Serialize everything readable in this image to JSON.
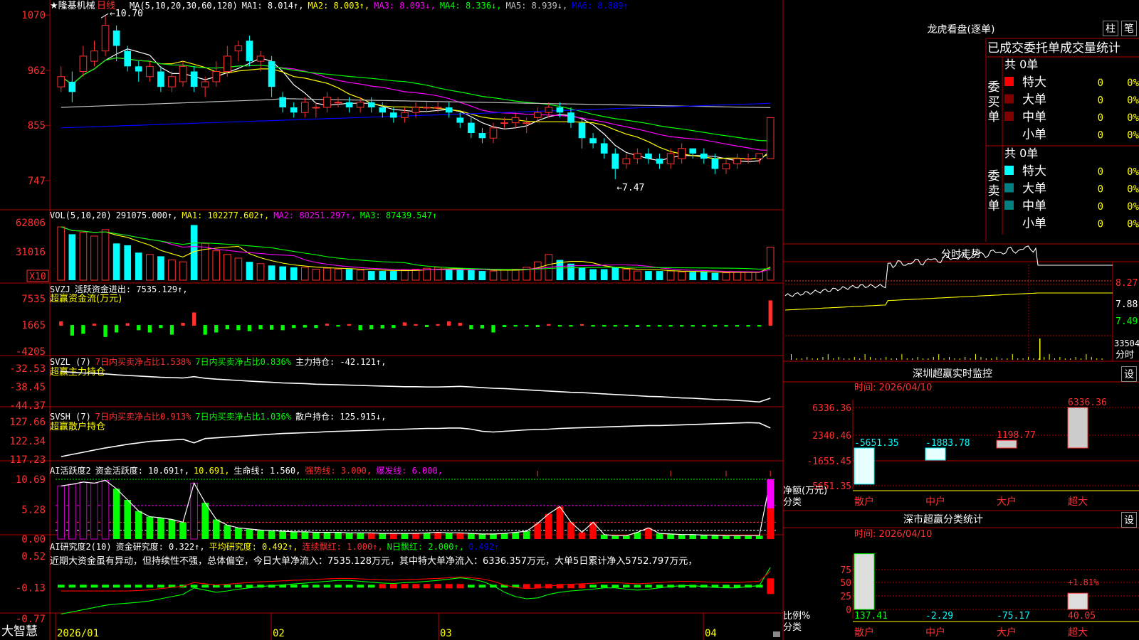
{
  "stock": {
    "star": "★",
    "name": "隆基机械",
    "period": "日线"
  },
  "colors": {
    "up": "#ff3030",
    "down": "#00ffff",
    "ma1": "#ffffff",
    "ma2": "#ffff00",
    "ma3": "#ff00ff",
    "ma4": "#00ff00",
    "ma5": "#c0c0c0",
    "ma6": "#0000ff",
    "grid": "#b00000"
  },
  "price_panel": {
    "header": [
      {
        "t": "MA(5,10,20,30,60,120)",
        "c": "#ffffff"
      },
      {
        "t": "MA1: 8.014↑,",
        "c": "#ffffff"
      },
      {
        "t": "MA2: 8.003↑,",
        "c": "#ffff00"
      },
      {
        "t": "MA3: 8.093↓,",
        "c": "#ff00ff"
      },
      {
        "t": "MA4: 8.336↓,",
        "c": "#00ff00"
      },
      {
        "t": "MA5: 8.939↓,",
        "c": "#c0c0c0"
      },
      {
        "t": "MA6: 8.889↑",
        "c": "#0000ff"
      }
    ],
    "axis": [
      "1070",
      "962",
      "855",
      "747"
    ],
    "high_label": "10.70",
    "low_label": "7.47"
  },
  "vol_panel": {
    "header": [
      {
        "t": "VOL(5,10,20)",
        "c": "#ffffff"
      },
      {
        "t": "291075.000↑,",
        "c": "#ffffff"
      },
      {
        "t": "MA1: 102277.602↑,",
        "c": "#ffff00"
      },
      {
        "t": "MA2: 80251.297↑,",
        "c": "#ff00ff"
      },
      {
        "t": "MA3: 87439.547↑",
        "c": "#00ff00"
      }
    ],
    "axis": [
      "62806",
      "31016"
    ],
    "unit": "X10"
  },
  "svzj_panel": {
    "header": [
      {
        "t": "SVZJ",
        "c": "#ffffff"
      },
      {
        "t": "活跃资金进出: 7535.129↑,",
        "c": "#ffffff"
      }
    ],
    "subtitle": "超赢资金流(万元)",
    "axis": [
      "7535",
      "1665",
      "-4205"
    ]
  },
  "svzl_panel": {
    "header": [
      {
        "t": "SVZL (7)",
        "c": "#ffffff"
      },
      {
        "t": "7日内买卖净占比1.538%",
        "c": "#ff3030"
      },
      {
        "t": "7日内买卖净占比0.836%",
        "c": "#00ff00"
      },
      {
        "t": "主力持仓: -42.121↑,",
        "c": "#ffffff"
      }
    ],
    "subtitle": "超赢主力持仓",
    "axis": [
      "-32.53",
      "-38.45",
      "-44.37"
    ]
  },
  "svsh_panel": {
    "header": [
      {
        "t": "SVSH (7)",
        "c": "#ffffff"
      },
      {
        "t": "7日内买卖净占比0.913%",
        "c": "#ff3030"
      },
      {
        "t": "7日内买卖净占比1.036%",
        "c": "#00ff00"
      },
      {
        "t": "散户持仓: 125.915↓,",
        "c": "#ffffff"
      }
    ],
    "subtitle": "超赢散户持仓",
    "axis": [
      "127.66",
      "122.34",
      "117.23"
    ]
  },
  "ai1_panel": {
    "header": [
      {
        "t": "AI活跃度2",
        "c": "#ffffff"
      },
      {
        "t": "资金活跃度: 10.691↑,",
        "c": "#ffffff"
      },
      {
        "t": "10.691,",
        "c": "#ffff00"
      },
      {
        "t": "生命线: 1.560,",
        "c": "#ffffff"
      },
      {
        "t": "强势线: 3.000,",
        "c": "#ff3030"
      },
      {
        "t": "爆发线: 6.000,",
        "c": "#ff00ff"
      }
    ],
    "axis": [
      "10.69",
      "5.28",
      "0.00"
    ]
  },
  "ai2_panel": {
    "header": [
      {
        "t": "AI研究度2(10)",
        "c": "#ffffff"
      },
      {
        "t": "资金研究度: 0.322↑,",
        "c": "#ffffff"
      },
      {
        "t": "平均研究度: 0.492↑,",
        "c": "#ffff00"
      },
      {
        "t": "连续飘红: 1.000↑,",
        "c": "#ff3030"
      },
      {
        "t": "N日飘红: 2.000↑,",
        "c": "#00ff00"
      },
      {
        "t": "0.492↑",
        "c": "#0000ff"
      }
    ],
    "comment": "近期大资金虽有异动，但持续性不强，总体偏空，今日大单净流入：7535.128万元，其中特大单净流入：6336.357万元，大单5日累计净入5752.797万元，",
    "axis": [
      "0.52",
      "-0.13",
      "-0.77"
    ]
  },
  "date_axis": {
    "labels": [
      "2026/01",
      "02",
      "03",
      "04"
    ],
    "brand": "大智慧"
  },
  "chart_data": {
    "type": "candlestick",
    "title": "隆基机械 日线",
    "ylim": [
      7.0,
      10.8
    ],
    "candles": [
      [
        9.3,
        9.5,
        9.2,
        9.7
      ],
      [
        9.4,
        9.2,
        9.0,
        9.6
      ],
      [
        9.6,
        9.9,
        9.5,
        10.1
      ],
      [
        9.8,
        10.0,
        9.7,
        10.2
      ],
      [
        10.0,
        10.5,
        9.9,
        10.7
      ],
      [
        10.4,
        10.1,
        9.8,
        10.5
      ],
      [
        10.0,
        9.7,
        9.6,
        10.1
      ],
      [
        9.7,
        9.6,
        9.4,
        9.8
      ],
      [
        9.5,
        9.7,
        9.4,
        9.8
      ],
      [
        9.6,
        9.3,
        9.2,
        9.7
      ],
      [
        9.3,
        9.5,
        9.2,
        9.6
      ],
      [
        9.4,
        9.7,
        9.3,
        9.8
      ],
      [
        9.6,
        9.3,
        9.2,
        9.7
      ],
      [
        9.3,
        9.4,
        9.1,
        9.5
      ],
      [
        9.4,
        9.6,
        9.3,
        9.8
      ],
      [
        9.6,
        9.9,
        9.5,
        10.1
      ],
      [
        10.0,
        10.1,
        9.8,
        10.2
      ],
      [
        10.2,
        9.8,
        9.7,
        10.3
      ],
      [
        9.8,
        9.9,
        9.6,
        10.0
      ],
      [
        9.8,
        9.3,
        9.1,
        9.9
      ],
      [
        9.1,
        8.9,
        8.8,
        9.2
      ],
      [
        8.9,
        8.8,
        8.7,
        9.0
      ],
      [
        8.8,
        9.0,
        8.7,
        9.1
      ],
      [
        8.9,
        8.9,
        8.7,
        9.0
      ],
      [
        8.9,
        9.1,
        8.8,
        9.2
      ],
      [
        9.0,
        9.0,
        8.9,
        9.1
      ],
      [
        9.0,
        8.9,
        8.8,
        9.1
      ],
      [
        8.9,
        9.0,
        8.8,
        9.1
      ],
      [
        9.0,
        8.9,
        8.8,
        9.1
      ],
      [
        8.9,
        8.8,
        8.7,
        9.0
      ],
      [
        8.8,
        8.7,
        8.6,
        8.9
      ],
      [
        8.7,
        8.8,
        8.6,
        8.9
      ],
      [
        8.8,
        8.9,
        8.7,
        9.0
      ],
      [
        8.9,
        8.9,
        8.8,
        9.0
      ],
      [
        8.9,
        8.9,
        8.8,
        9.0
      ],
      [
        8.9,
        8.8,
        8.7,
        9.0
      ],
      [
        8.7,
        8.6,
        8.5,
        8.8
      ],
      [
        8.6,
        8.4,
        8.3,
        8.7
      ],
      [
        8.4,
        8.3,
        8.2,
        8.5
      ],
      [
        8.3,
        8.5,
        8.2,
        8.6
      ],
      [
        8.6,
        8.6,
        8.5,
        8.7
      ],
      [
        8.6,
        8.7,
        8.5,
        8.8
      ],
      [
        8.6,
        8.6,
        8.4,
        8.7
      ],
      [
        8.7,
        8.8,
        8.6,
        8.9
      ],
      [
        8.8,
        8.9,
        8.7,
        9.0
      ],
      [
        8.9,
        8.8,
        8.7,
        9.0
      ],
      [
        8.8,
        8.6,
        8.5,
        8.9
      ],
      [
        8.6,
        8.3,
        8.1,
        8.7
      ],
      [
        8.3,
        8.2,
        8.1,
        8.4
      ],
      [
        8.2,
        8.0,
        7.9,
        8.3
      ],
      [
        8.0,
        7.7,
        7.5,
        8.1
      ],
      [
        7.8,
        7.9,
        7.7,
        8.0
      ],
      [
        7.9,
        8.0,
        7.8,
        8.1
      ],
      [
        8.0,
        7.9,
        7.8,
        8.1
      ],
      [
        7.9,
        7.8,
        7.7,
        8.0
      ],
      [
        7.8,
        8.0,
        7.7,
        8.1
      ],
      [
        7.9,
        8.1,
        7.8,
        8.2
      ],
      [
        8.1,
        8.0,
        7.9,
        8.1
      ],
      [
        8.0,
        7.9,
        7.8,
        8.1
      ],
      [
        7.9,
        7.7,
        7.6,
        8.0
      ],
      [
        7.7,
        7.8,
        7.6,
        7.9
      ],
      [
        7.8,
        7.9,
        7.7,
        8.0
      ],
      [
        7.9,
        7.9,
        7.8,
        8.0
      ],
      [
        7.9,
        8.0,
        7.8,
        8.0
      ],
      [
        7.9,
        8.7,
        7.9,
        8.7
      ]
    ],
    "volume": [
      58,
      50,
      52,
      48,
      55,
      40,
      38,
      30,
      28,
      26,
      22,
      20,
      60,
      40,
      32,
      28,
      24,
      20,
      18,
      16,
      15,
      14,
      14,
      12,
      13,
      12,
      12,
      11,
      10,
      10,
      10,
      11,
      12,
      13,
      14,
      12,
      12,
      11,
      10,
      10,
      11,
      12,
      14,
      20,
      28,
      22,
      18,
      14,
      12,
      12,
      14,
      12,
      10,
      10,
      10,
      10,
      9,
      9,
      9,
      8,
      8,
      9,
      9,
      9,
      36
    ],
    "flow": [
      0.8,
      -2.2,
      -1.8,
      0.3,
      -2.5,
      -1.5,
      0.4,
      -1.0,
      -1.5,
      -0.5,
      -2.0,
      0.5,
      2.8,
      -2.0,
      -1.5,
      -0.8,
      -1.0,
      -1.2,
      -0.8,
      -0.9,
      -1.0,
      -0.5,
      -0.4,
      -0.5,
      0.3,
      -0.2,
      0.2,
      -1.0,
      -0.8,
      -0.6,
      -0.5,
      0.6,
      0.2,
      -0.3,
      0.2,
      0.8,
      0.5,
      -0.8,
      -0.6,
      -1.5,
      -0.3,
      -0.2,
      -0.2,
      -0.3,
      0.2,
      -0.2,
      -0.2,
      0.2,
      -0.2,
      -0.2,
      -0.2,
      -0.2,
      -0.3,
      -0.2,
      -0.2,
      -0.2,
      -0.2,
      -0.2,
      -0.2,
      -0.2,
      -0.2,
      -0.2,
      -0.2,
      -0.2,
      5.5
    ],
    "main_hold": [
      -33.5,
      -33.8,
      -34.0,
      -34.1,
      -34.3,
      -34.6,
      -34.8,
      -35.0,
      -35.2,
      -35.4,
      -35.5,
      -35.6,
      -35.2,
      -35.7,
      -36.0,
      -36.2,
      -36.4,
      -36.6,
      -36.8,
      -37.0,
      -37.2,
      -37.3,
      -37.4,
      -37.6,
      -37.7,
      -37.8,
      -37.9,
      -38.0,
      -38.1,
      -38.2,
      -38.3,
      -38.4,
      -38.4,
      -38.5,
      -38.5,
      -38.4,
      -38.3,
      -38.5,
      -38.7,
      -38.9,
      -39.0,
      -39.2,
      -39.4,
      -39.6,
      -39.8,
      -40.0,
      -40.2,
      -40.3,
      -40.5,
      -40.7,
      -40.9,
      -41.1,
      -41.3,
      -41.5,
      -41.6,
      -41.8,
      -42.0,
      -42.1,
      -42.3,
      -42.5,
      -42.6,
      -42.8,
      -43.0,
      -43.3,
      -42.1
    ],
    "retail_hold": [
      118.0,
      118.6,
      119.2,
      119.8,
      120.4,
      120.9,
      121.4,
      121.8,
      122.2,
      122.4,
      122.6,
      122.8,
      121.8,
      123.0,
      123.2,
      123.4,
      123.6,
      123.8,
      124.0,
      124.2,
      124.4,
      124.5,
      124.6,
      124.7,
      124.9,
      125.0,
      125.1,
      125.2,
      125.3,
      125.4,
      125.5,
      125.6,
      125.7,
      125.8,
      125.8,
      125.9,
      125.9,
      125.6,
      125.0,
      124.8,
      125.0,
      125.2,
      125.4,
      125.5,
      125.6,
      125.8,
      125.9,
      126.0,
      126.1,
      126.2,
      126.3,
      126.4,
      126.5,
      126.6,
      126.6,
      126.7,
      126.8,
      126.9,
      127.0,
      127.1,
      127.2,
      127.3,
      127.4,
      127.3,
      125.9
    ],
    "activity": [
      9.5,
      9.8,
      10.2,
      10.0,
      10.5,
      9.0,
      7.0,
      5.0,
      4.0,
      3.8,
      3.5,
      3.0,
      10.0,
      6.5,
      3.5,
      2.5,
      2.0,
      1.8,
      1.6,
      1.5,
      1.4,
      1.3,
      1.3,
      1.2,
      1.2,
      1.2,
      1.1,
      1.1,
      1.1,
      1.0,
      1.0,
      1.0,
      1.0,
      1.1,
      1.2,
      1.1,
      1.1,
      1.0,
      0.9,
      0.9,
      1.0,
      1.2,
      1.4,
      2.8,
      4.5,
      5.8,
      3.0,
      1.2,
      3.0,
      0.8,
      0.6,
      0.6,
      1.2,
      2.0,
      1.0,
      0.9,
      0.8,
      0.8,
      0.7,
      0.7,
      0.6,
      0.6,
      0.6,
      0.6,
      10.69
    ],
    "research": [
      -0.75,
      -0.7,
      -0.65,
      -0.6,
      -0.55,
      -0.52,
      -0.5,
      -0.48,
      -0.45,
      -0.4,
      -0.35,
      -0.3,
      -0.15,
      -0.2,
      -0.25,
      -0.22,
      -0.18,
      -0.15,
      -0.12,
      -0.1,
      -0.08,
      -0.06,
      -0.04,
      -0.02,
      0.0,
      0.02,
      0.02,
      0.0,
      -0.02,
      -0.04,
      -0.05,
      -0.03,
      -0.02,
      0.0,
      0.02,
      0.05,
      0.08,
      0.05,
      0.0,
      -0.1,
      -0.25,
      -0.35,
      -0.4,
      -0.38,
      -0.3,
      -0.25,
      -0.22,
      -0.2,
      -0.18,
      -0.15,
      -0.15,
      -0.18,
      -0.2,
      -0.18,
      -0.15,
      -0.12,
      -0.1,
      -0.1,
      -0.12,
      -0.14,
      -0.15,
      -0.15,
      -0.12,
      -0.1,
      0.32
    ]
  },
  "right": {
    "lhkp_title": "龙虎看盘(逐单)",
    "btn_bar": "柱",
    "btn_pen": "笔",
    "table_title": "已成交委托单成交量统计",
    "buy": {
      "side": "委买单",
      "total": "共 0单",
      "rows": [
        {
          "name": "特大",
          "vol": "0",
          "pct": "0%",
          "color": "#ff0000"
        },
        {
          "name": "大单",
          "vol": "0",
          "pct": "0%",
          "color": "#800000"
        },
        {
          "name": "中单",
          "vol": "0",
          "pct": "0%",
          "color": "#800000"
        },
        {
          "name": "小单",
          "vol": "0",
          "pct": "0%",
          "color": ""
        }
      ]
    },
    "sell": {
      "side": "委卖单",
      "total": "共 0单",
      "rows": [
        {
          "name": "特大",
          "vol": "0",
          "pct": "0%",
          "color": "#00ffff"
        },
        {
          "name": "大单",
          "vol": "0",
          "pct": "0%",
          "color": "#008080"
        },
        {
          "name": "中单",
          "vol": "0",
          "pct": "0%",
          "color": "#008080"
        },
        {
          "name": "小单",
          "vol": "0",
          "pct": "0%",
          "color": ""
        }
      ]
    },
    "intraday": {
      "title": "分时走势",
      "axis": [
        "8.27",
        "7.88",
        "7.49"
      ],
      "vol_label": "33504",
      "foot": "分时"
    },
    "sz_monitor": {
      "title": "深圳超赢实时监控",
      "set": "设",
      "time": "时间: 2026/04/10",
      "axis": [
        "6336.36",
        "2340.46",
        "-1655.45",
        "-5651.35"
      ],
      "bars": [
        {
          "cat": "散户",
          "val": -5651.35,
          "label": "-5651.35"
        },
        {
          "cat": "中户",
          "val": -1883.78,
          "label": "-1883.78"
        },
        {
          "cat": "大户",
          "val": 1198.77,
          "label": "1198.77"
        },
        {
          "cat": "超大",
          "val": 6336.36,
          "label": "6336.36"
        }
      ],
      "ylabel": "净额(万元)",
      "xlabel": "分类"
    },
    "sz_class": {
      "title": "深市超赢分类统计",
      "set": "设",
      "time": "时间: 2026/04/10",
      "axis": [
        "75",
        "50",
        "25",
        "0"
      ],
      "bars": [
        {
          "cat": "散户",
          "val": 137.41,
          "label": "137.41"
        },
        {
          "cat": "中户",
          "val": -2.29,
          "label": "-2.29"
        },
        {
          "cat": "大户",
          "val": -75.17,
          "label": "-75.17"
        },
        {
          "cat": "超大",
          "val": 40.05,
          "label": "40.05"
        }
      ],
      "extra_label": "+1.81%",
      "ylabel": "比例%",
      "xlabel": "分类"
    }
  }
}
